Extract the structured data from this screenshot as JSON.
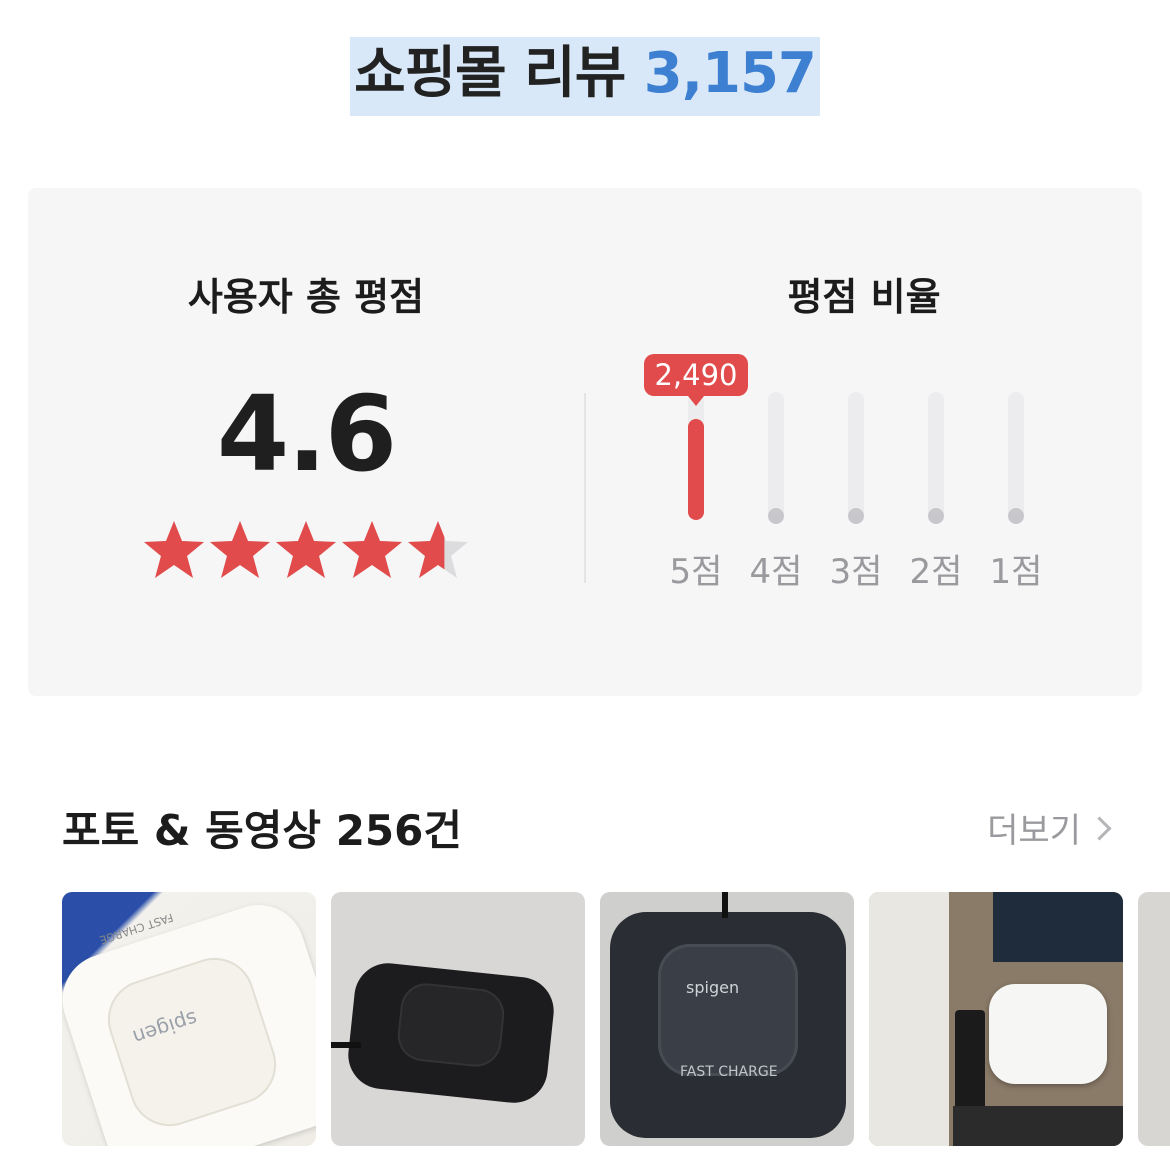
{
  "header": {
    "title": "쇼핑몰 리뷰",
    "review_count": "3,157"
  },
  "rating_summary": {
    "heading": "사용자 총 평점",
    "score": "4.6",
    "star_rating": 4.6,
    "max_stars": 5,
    "star_color": "#e24b4b"
  },
  "rating_ratio": {
    "heading": "평점 비율",
    "highlight_count": "2,490",
    "bars": [
      {
        "label": "5점",
        "ratio": 0.79,
        "highlight": true
      },
      {
        "label": "4점",
        "ratio": 0.0,
        "highlight": false
      },
      {
        "label": "3점",
        "ratio": 0.0,
        "highlight": false
      },
      {
        "label": "2점",
        "ratio": 0.0,
        "highlight": false
      },
      {
        "label": "1점",
        "ratio": 0.0,
        "highlight": false
      }
    ],
    "accent_color": "#e24b4b"
  },
  "photos_section": {
    "title": "포토 & 동영상 256건",
    "more_label": "더보기",
    "photos": [
      {
        "alt": "white wireless charger",
        "brand_text": "spigen",
        "badge": "FAST CHARGE"
      },
      {
        "alt": "black wireless charger",
        "brand_text": "",
        "badge": ""
      },
      {
        "alt": "black wireless charger top view",
        "brand_text": "spigen",
        "badge": "FAST CHARGE"
      },
      {
        "alt": "white charger on desk",
        "brand_text": "",
        "badge": ""
      },
      {
        "alt": "partial photo",
        "brand_text": "",
        "badge": ""
      }
    ]
  }
}
